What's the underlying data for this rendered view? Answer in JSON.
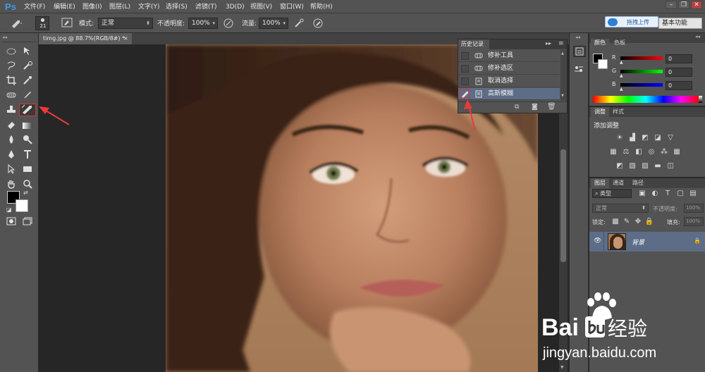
{
  "menubar": {
    "logo": "Ps",
    "items": [
      "文件(F)",
      "编辑(E)",
      "图像(I)",
      "图层(L)",
      "文字(Y)",
      "选择(S)",
      "滤镜(T)",
      "3D(D)",
      "视图(V)",
      "窗口(W)",
      "帮助(H)"
    ],
    "window_buttons": [
      "–",
      "❐",
      "✕"
    ]
  },
  "optionsbar": {
    "brush_size": "21",
    "mode_label": "模式:",
    "mode_value": "正常",
    "opacity_label": "不透明度:",
    "opacity_value": "100%",
    "flow_label": "流量:",
    "flow_value": "100%",
    "upload_button": "拖拽上传",
    "workspace": "基本功能"
  },
  "document": {
    "tab_title": "timg.jpg @ 88.7%(RGB/8#) *",
    "tab_close": "×"
  },
  "history_panel": {
    "tab": "历史记录",
    "items": [
      {
        "label": "修补工具",
        "icon": "patch-tool-icon",
        "selected": false
      },
      {
        "label": "修补选区",
        "icon": "patch-tool-icon",
        "selected": false
      },
      {
        "label": "取消选择",
        "icon": "document-icon",
        "selected": false
      },
      {
        "label": "高斯模糊",
        "icon": "document-icon",
        "selected": true
      }
    ]
  },
  "color_panel": {
    "tabs": [
      "颜色",
      "色板"
    ],
    "channels": [
      {
        "label": "R",
        "value": "0",
        "color": "#ff0000"
      },
      {
        "label": "G",
        "value": "0",
        "color": "#00ff00"
      },
      {
        "label": "B",
        "value": "0",
        "color": "#0000ff"
      }
    ]
  },
  "adjust_panel": {
    "tabs": [
      "调整",
      "样式"
    ],
    "title": "添加调整"
  },
  "layers_panel": {
    "tabs": [
      "图层",
      "通道",
      "路径"
    ],
    "filter_label": "类型",
    "blend_mode": "正常",
    "opacity_label": "不透明度:",
    "opacity_value": "100%",
    "lock_label": "锁定:",
    "fill_label": "填充:",
    "fill_value": "100%",
    "layer_name": "背景"
  },
  "watermark": {
    "brand": "Bai",
    "brand_suffix": "经验",
    "url": "jingyan.baidu.com"
  },
  "colors": {
    "accent_selection": "#5d6d87",
    "annotation_red": "#e83a3a"
  }
}
